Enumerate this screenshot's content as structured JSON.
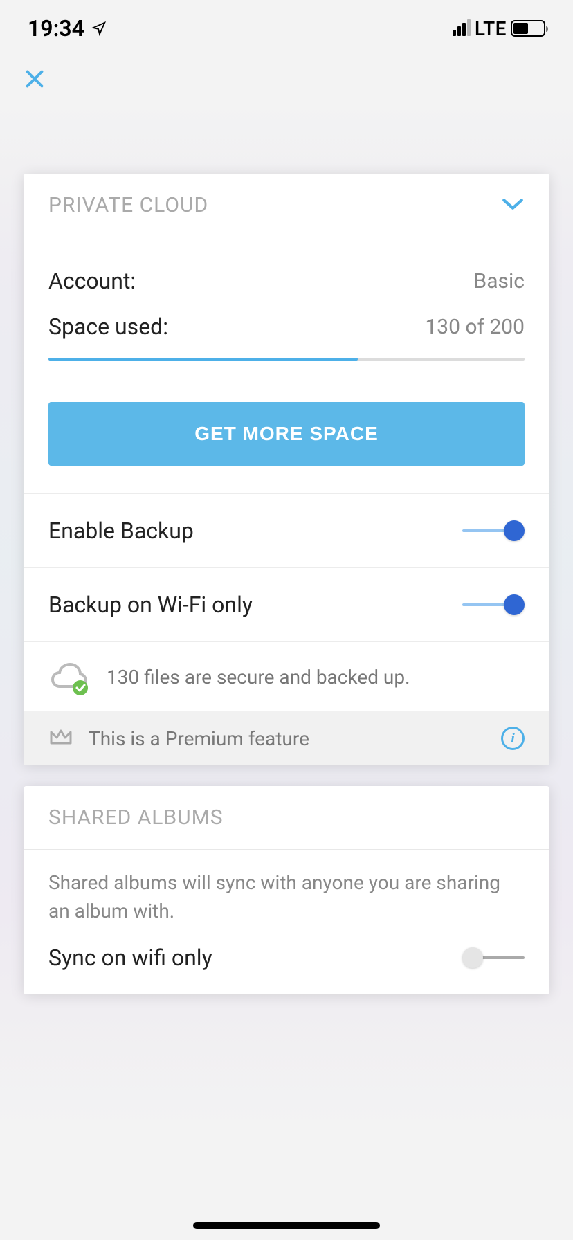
{
  "status_bar": {
    "time": "19:34",
    "network": "LTE"
  },
  "private_cloud": {
    "title": "PRIVATE CLOUD",
    "account_label": "Account:",
    "account_value": "Basic",
    "space_label": "Space used:",
    "space_value": "130 of 200",
    "space_used": 130,
    "space_total": 200,
    "get_more_label": "GET MORE SPACE",
    "enable_backup_label": "Enable Backup",
    "enable_backup_on": true,
    "wifi_only_label": "Backup on Wi-Fi only",
    "wifi_only_on": true,
    "backup_status": "130 files are secure and backed up.",
    "premium_note": "This is a Premium feature"
  },
  "shared_albums": {
    "title": "SHARED ALBUMS",
    "description": "Shared albums will sync with anyone you are sharing an album with.",
    "sync_wifi_label": "Sync on wifi only",
    "sync_wifi_on": false
  }
}
